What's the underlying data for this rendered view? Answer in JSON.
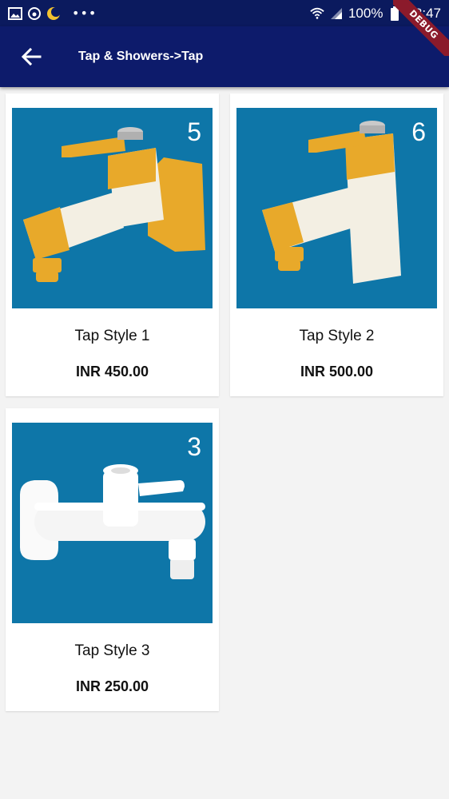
{
  "status_bar": {
    "battery": "100%",
    "time": "08:47",
    "dots": "•••"
  },
  "app_bar": {
    "title": "Tap & Showers->Tap"
  },
  "debug_banner": "DEBUG",
  "colors": {
    "app_bar": "#0d1b6b",
    "image_background": "#0e76a8",
    "accent_yellow": "#e8a92a"
  },
  "products": [
    {
      "number": "5",
      "name": "Tap Style 1",
      "price": "INR 450.00"
    },
    {
      "number": "6",
      "name": "Tap Style 2",
      "price": "INR 500.00"
    },
    {
      "number": "3",
      "name": "Tap Style 3",
      "price": "INR 250.00"
    }
  ]
}
